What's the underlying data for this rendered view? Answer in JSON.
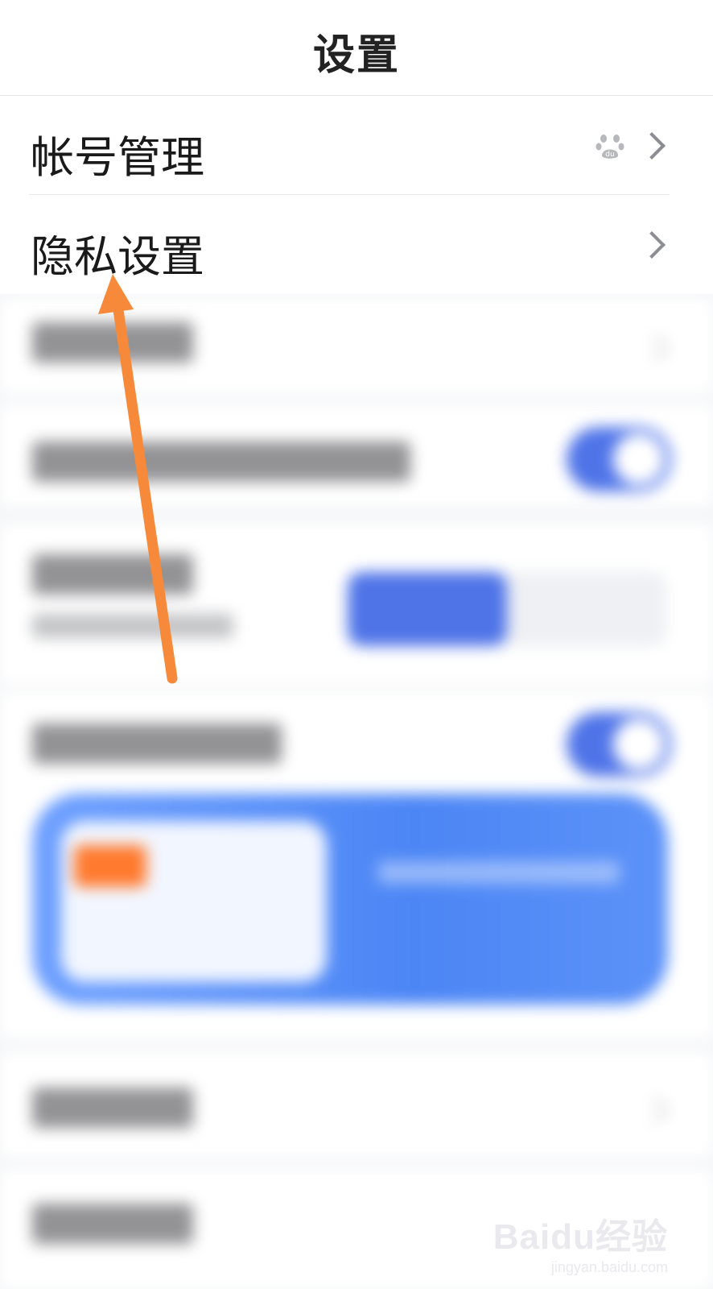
{
  "header": {
    "title": "设置"
  },
  "settings": [
    {
      "label": "帐号管理",
      "has_baidu_icon": true
    },
    {
      "label": "隐私设置",
      "has_baidu_icon": false
    }
  ],
  "annotation": {
    "arrow_color": "#f68a3a"
  },
  "watermark": {
    "main": "Baidu经验",
    "sub": "jingyan.baidu.com"
  },
  "colors": {
    "accent": "#4f74e8"
  }
}
